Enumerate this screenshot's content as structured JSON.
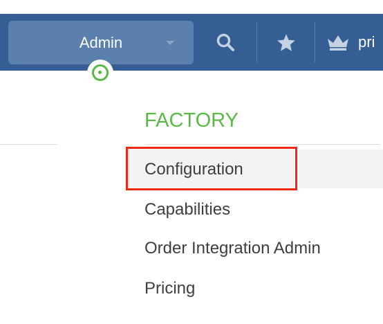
{
  "navbar": {
    "admin_select_value": "Admin",
    "user_label": "pri",
    "background_color": "#355f94",
    "select_color": "#5b80ae",
    "icons": [
      "chevron-down-icon",
      "search-icon",
      "star-icon",
      "crown-icon",
      "status-indicator-icon"
    ]
  },
  "menu": {
    "heading": "FACTORY",
    "heading_color": "#5ab946",
    "items": [
      {
        "label": "Configuration",
        "highlighted": true
      },
      {
        "label": "Capabilities"
      },
      {
        "label": "Order Integration Admin"
      },
      {
        "label": "Pricing"
      }
    ],
    "highlight_color": "#ef2a12"
  }
}
